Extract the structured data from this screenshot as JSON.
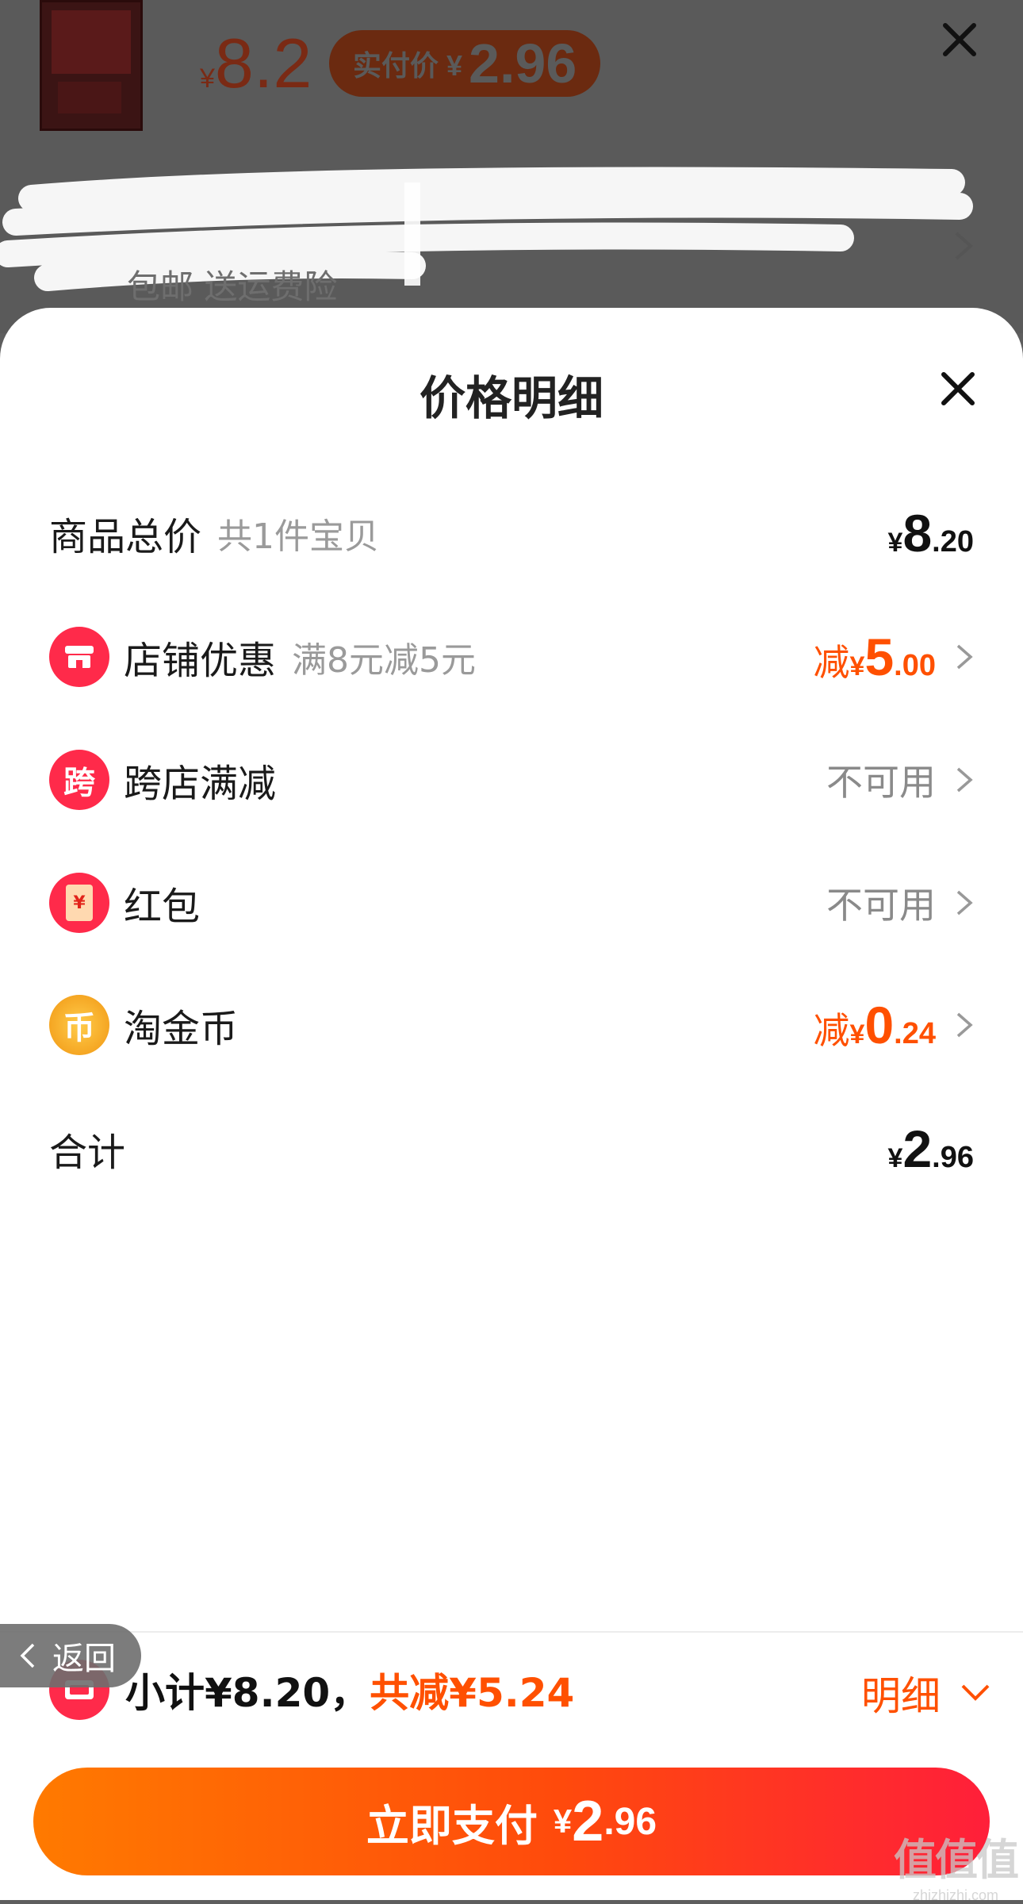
{
  "background": {
    "price_symbol": "¥",
    "price": "8.2",
    "actual_label": "实付价 ¥",
    "actual_value": "2.96",
    "shipping_text": "包邮 送运费险"
  },
  "sheet": {
    "title": "价格明细",
    "rows": [
      {
        "label": "商品总价",
        "sub": "共1件宝贝",
        "yen": "¥",
        "int": "8",
        "dec": ".20"
      },
      {
        "label": "店铺优惠",
        "sub": "满8元减5元",
        "jian": "减",
        "yen": "¥",
        "int": "5",
        "dec": ".00",
        "icon": "store-icon"
      },
      {
        "label": "跨店满减",
        "status": "不可用",
        "icon_text": "跨",
        "icon": "cross-store-icon"
      },
      {
        "label": "红包",
        "status": "不可用",
        "icon_text": "¥",
        "icon": "red-packet-icon"
      },
      {
        "label": "淘金币",
        "jian": "减",
        "yen": "¥",
        "int": "0",
        "dec": ".24",
        "icon_text": "币",
        "icon": "gold-coin-icon"
      },
      {
        "label": "合计",
        "yen": "¥",
        "int": "2",
        "dec": ".96"
      }
    ]
  },
  "bottom": {
    "back_label": "返回",
    "subtotal": "小计¥8.20，",
    "saved": "共减¥5.24",
    "detail_label": "明细",
    "pay_label": "立即支付",
    "pay_yen": "¥",
    "pay_int": "2",
    "pay_dec": ".96"
  },
  "watermark": {
    "line1": "值值值",
    "line2": "zhizhizhi.com"
  },
  "colors": {
    "accent": "#ff5000",
    "red": "#ff2a4a",
    "gold": "#f5a623"
  }
}
